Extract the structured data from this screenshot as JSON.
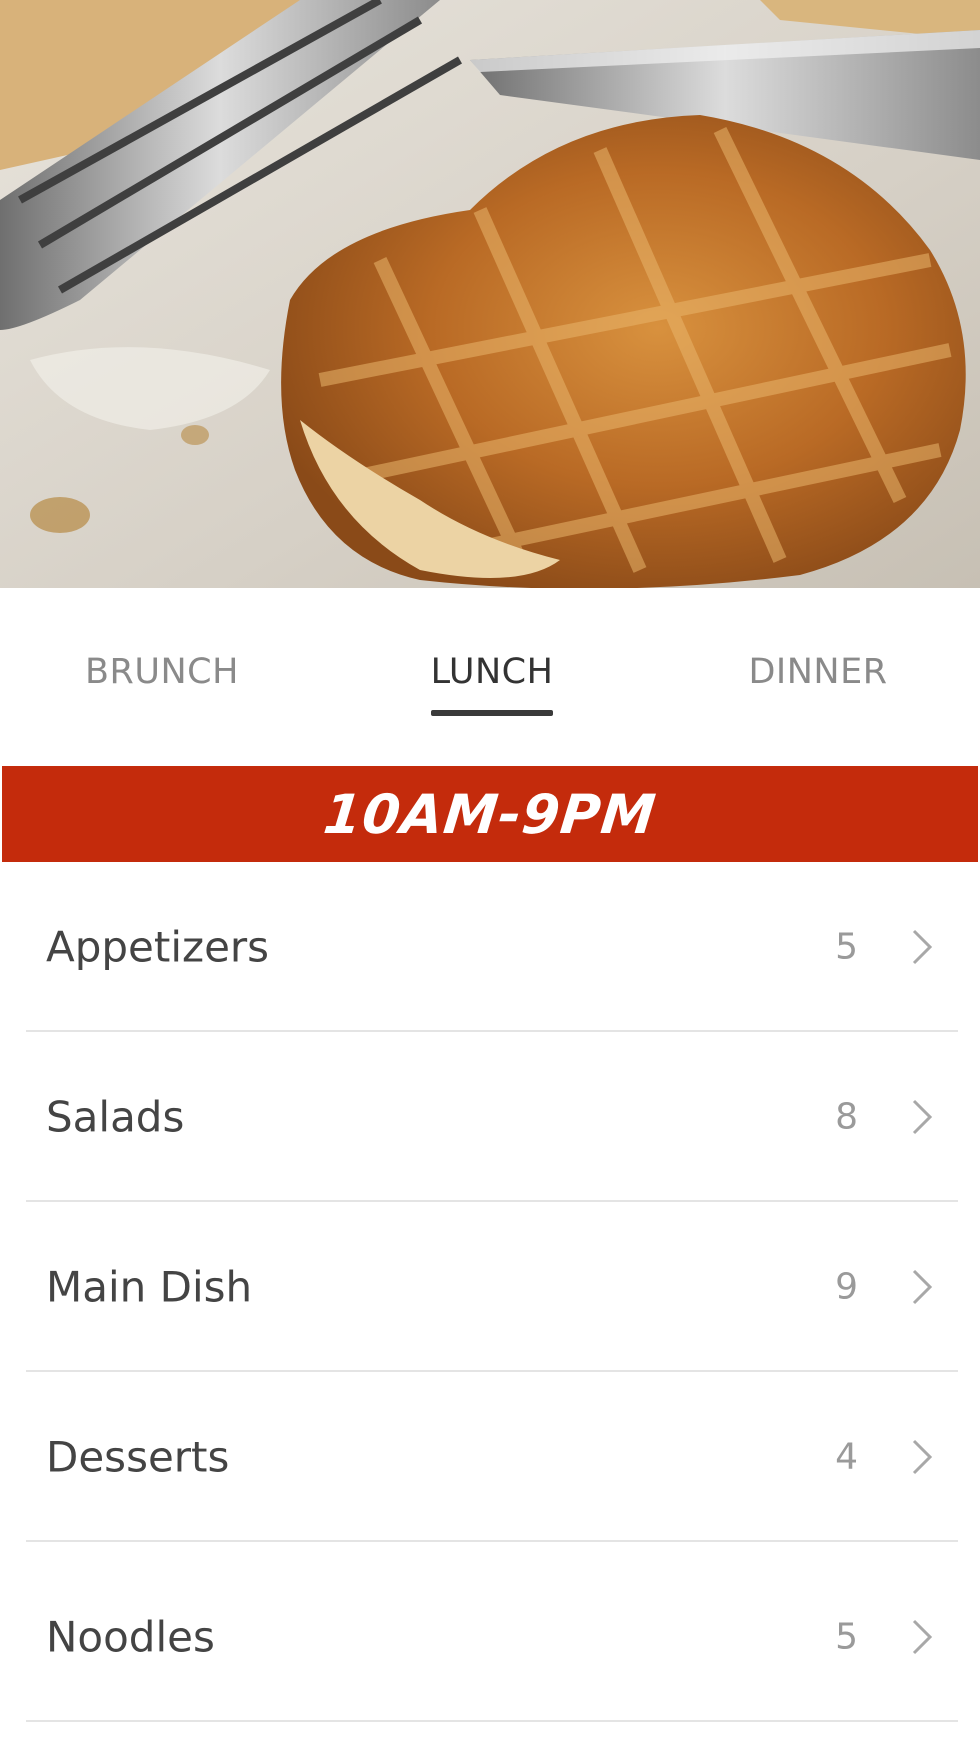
{
  "tabs": [
    {
      "label": "BRUNCH",
      "active": false
    },
    {
      "label": "LUNCH",
      "active": true
    },
    {
      "label": "DINNER",
      "active": false
    }
  ],
  "hours": "10AM-9PM",
  "categories": [
    {
      "label": "Appetizers",
      "count": "5"
    },
    {
      "label": "Salads",
      "count": "8"
    },
    {
      "label": "Main Dish",
      "count": "9"
    },
    {
      "label": "Desserts",
      "count": "4"
    },
    {
      "label": "Noodles",
      "count": "5"
    }
  ],
  "colors": {
    "banner": "#c42b0c",
    "tab_active": "#333333",
    "tab_inactive": "#8a8a8a"
  },
  "icons": [
    "chevron-right-icon"
  ]
}
